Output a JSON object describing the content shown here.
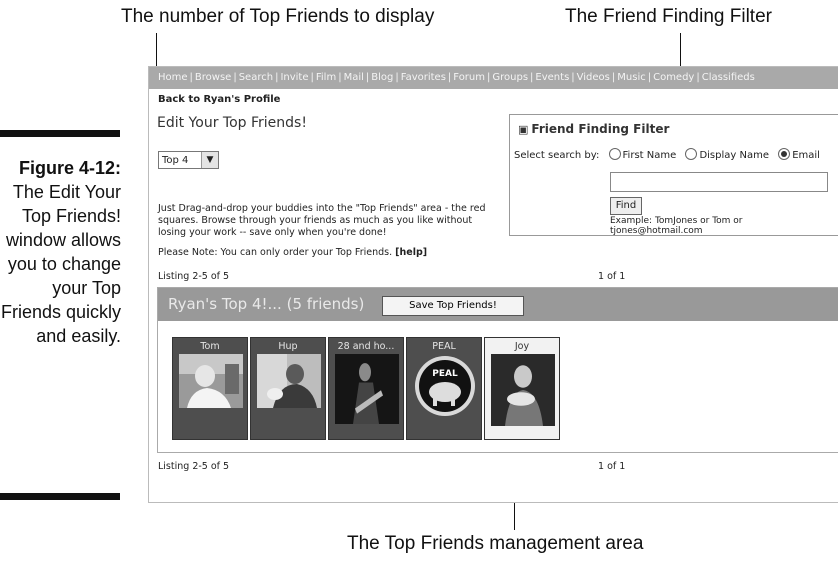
{
  "callouts": {
    "top_left": "The number of Top Friends to display",
    "top_right": "The Friend Finding Filter",
    "bottom": "The Top Friends management area"
  },
  "figure": {
    "label": "Figure 4-12:",
    "text": "The Edit Your Top Friends! window allows you to change your Top Friends quickly and easily."
  },
  "nav": {
    "items": [
      "Home",
      "Browse",
      "Search",
      "Invite",
      "Film",
      "Mail",
      "Blog",
      "Favorites",
      "Forum",
      "Groups",
      "Events",
      "Videos",
      "Music",
      "Comedy",
      "Classifieds"
    ]
  },
  "page": {
    "back_link": "Back to Ryan's Profile",
    "title": "Edit Your Top Friends!",
    "select_value": "Top 4",
    "description": "Just Drag-and-drop your buddies into the \"Top Friends\" area - the red squares. Browse through your friends as much as you like without losing your work -- save only when you're done!",
    "note_prefix": "Please Note: You can only order your Top Friends.",
    "note_help": "[help]",
    "listing_top": "Listing 2-5 of 5",
    "pager_top": "1  of 1",
    "listing_bottom": "Listing 2-5 of 5",
    "pager_bottom": "1  of 1"
  },
  "filter": {
    "title": "Friend Finding Filter",
    "select_label": "Select search by:",
    "options": [
      "First Name",
      "Display Name",
      "Email"
    ],
    "selected": "Email",
    "find_button": "Find",
    "example_line1": "Example: TomJones or Tom or",
    "example_line2": "tjones@hotmail.com"
  },
  "top_friends": {
    "header": "Ryan's Top 4!...   (5 friends)",
    "save_button": "Save Top Friends!",
    "friends": [
      {
        "name": "Tom"
      },
      {
        "name": "Hup"
      },
      {
        "name": "28 and ho..."
      },
      {
        "name": "PEAL",
        "logo_text": "PEAL"
      },
      {
        "name": "Joy"
      }
    ]
  }
}
